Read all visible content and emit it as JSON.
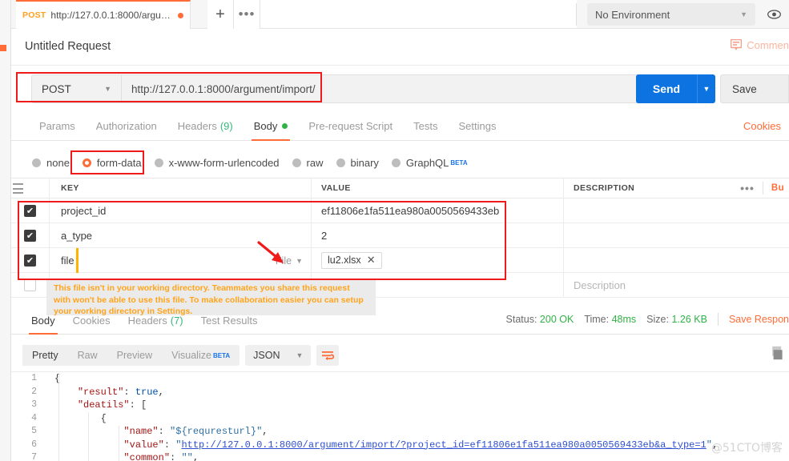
{
  "tab": {
    "method": "POST",
    "url": "http://127.0.0.1:8000/argume...",
    "plus_label": "+",
    "more_label": "•••"
  },
  "environment": {
    "selected": "No Environment",
    "caret": "▼",
    "eye_icon": "👁"
  },
  "request": {
    "title": "Untitled Request",
    "comments_label": "Commen",
    "method": "POST",
    "method_caret": "▼",
    "url": "http://127.0.0.1:8000/argument/import/",
    "send_label": "Send",
    "send_caret": "▼",
    "save_label": "Save"
  },
  "request_tabs": [
    {
      "label": "Params",
      "active": false
    },
    {
      "label": "Authorization",
      "active": false
    },
    {
      "label": "Headers",
      "count": "(9)",
      "active": false
    },
    {
      "label": "Body",
      "active": true,
      "dot": true
    },
    {
      "label": "Pre-request Script",
      "active": false
    },
    {
      "label": "Tests",
      "active": false
    },
    {
      "label": "Settings",
      "active": false
    }
  ],
  "cookies_link": "Cookies",
  "body_types": [
    {
      "label": "none",
      "selected": false
    },
    {
      "label": "form-data",
      "selected": true
    },
    {
      "label": "x-www-form-urlencoded",
      "selected": false
    },
    {
      "label": "raw",
      "selected": false
    },
    {
      "label": "binary",
      "selected": false
    },
    {
      "label": "GraphQL",
      "selected": false,
      "beta": "BETA"
    }
  ],
  "table": {
    "headers": {
      "key": "KEY",
      "value": "VALUE",
      "description": "DESCRIPTION"
    },
    "actions": {
      "dots": "•••",
      "bulk_edit": "Bu"
    },
    "rows": [
      {
        "checked": true,
        "key": "project_id",
        "value": "ef11806e1fa511ea980a0050569433eb",
        "description": ""
      },
      {
        "checked": true,
        "key": "a_type",
        "value": "2",
        "description": ""
      },
      {
        "checked": true,
        "key": "file",
        "type_label": "File",
        "type_caret": "▼",
        "file_name": "lu2.xlsx",
        "file_remove": "✕",
        "description": ""
      },
      {
        "checked": false,
        "key": "",
        "value": "",
        "description": "Description",
        "placeholder_row": true
      }
    ]
  },
  "warning": "This file isn't in your working directory. Teammates you share this request with won't be able to use this file. To make collaboration easier you can setup your working directory in Settings.",
  "response_tabs": [
    {
      "label": "Body",
      "active": true
    },
    {
      "label": "Cookies",
      "active": false
    },
    {
      "label": "Headers",
      "count": "(7)",
      "active": false
    },
    {
      "label": "Test Results",
      "active": false
    }
  ],
  "response_meta": {
    "status_label": "Status:",
    "status_value": "200 OK",
    "time_label": "Time:",
    "time_value": "48ms",
    "size_label": "Size:",
    "size_value": "1.26 KB",
    "save_response": "Save Respon"
  },
  "view_toolbar": {
    "views": [
      {
        "label": "Pretty",
        "active": true
      },
      {
        "label": "Raw",
        "active": false
      },
      {
        "label": "Preview",
        "active": false
      },
      {
        "label": "Visualize",
        "active": false,
        "beta": "BETA"
      }
    ],
    "format": "JSON",
    "format_caret": "▼",
    "wrap_icon": "⇶"
  },
  "code_lines": [
    {
      "n": "1",
      "text": "{"
    },
    {
      "n": "2",
      "text": "    \"result\": true,"
    },
    {
      "n": "3",
      "text": "    \"deatils\": ["
    },
    {
      "n": "4",
      "text": "        {"
    },
    {
      "n": "5",
      "text": "            \"name\": \"${requresturl}\","
    },
    {
      "n": "6",
      "text": "            \"value\": \"http://127.0.0.1:8000/argument/import/?project_id=ef11806e1fa511ea980a0050569433eb&a_type=1\","
    },
    {
      "n": "7",
      "text": "            \"common\": \"\","
    }
  ],
  "watermark": "@51CTO博客",
  "colors": {
    "accent_orange": "#ff6c37",
    "send_blue": "#0d73e0",
    "status_green": "#2fb344",
    "warning_yellow": "#ffa41b",
    "annotation_red": "#ef1b1b"
  }
}
